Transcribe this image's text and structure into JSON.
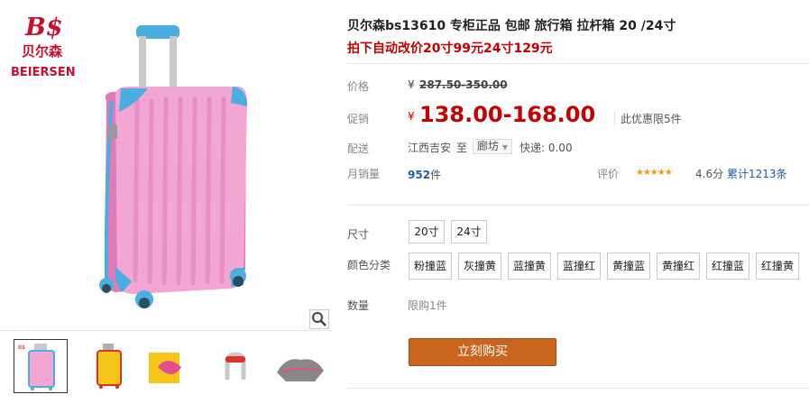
{
  "brand": {
    "logo_mark": "B$",
    "logo_cn": "贝尔森",
    "logo_en": "BEIERSEN"
  },
  "product": {
    "title": "贝尔森bs13610 专柜正品 包邮 旅行箱 拉杆箱 20 /24寸",
    "promo": "拍下自动改价20寸99元24寸129元"
  },
  "price": {
    "label": "价格",
    "currency": "¥",
    "original": "287.50-350.00",
    "promo_label": "促销",
    "promo_value": "138.00-168.00",
    "limit": "此优惠限5件"
  },
  "shipping": {
    "label": "配送",
    "from": "江西吉安",
    "to_word": "至",
    "destination": "廊坊",
    "express": "快递: 0.00"
  },
  "sales": {
    "label": "月销量",
    "count": "952",
    "unit": "件",
    "rating_label": "评价",
    "stars": "★★★★★",
    "score": "4.6分",
    "reviews": "累计1213条"
  },
  "options": {
    "size_label": "尺寸",
    "sizes": [
      "20寸",
      "24寸"
    ],
    "color_label": "颜色分类",
    "colors": [
      "粉撞蓝",
      "灰撞黄",
      "蓝撞黄",
      "蓝撞红",
      "黄撞蓝",
      "黄撞红",
      "红撞蓝",
      "红撞黄"
    ],
    "qty_label": "数量",
    "qty_note": "限购1件"
  },
  "actions": {
    "buy_now": "立刻购买"
  },
  "icons": {
    "zoom": "magnifier-icon",
    "expand": "chevron-down-icon"
  },
  "colors": {
    "accent_red": "#c40000",
    "buy_button": "#c9651e",
    "link_blue": "#1f5fa8"
  }
}
